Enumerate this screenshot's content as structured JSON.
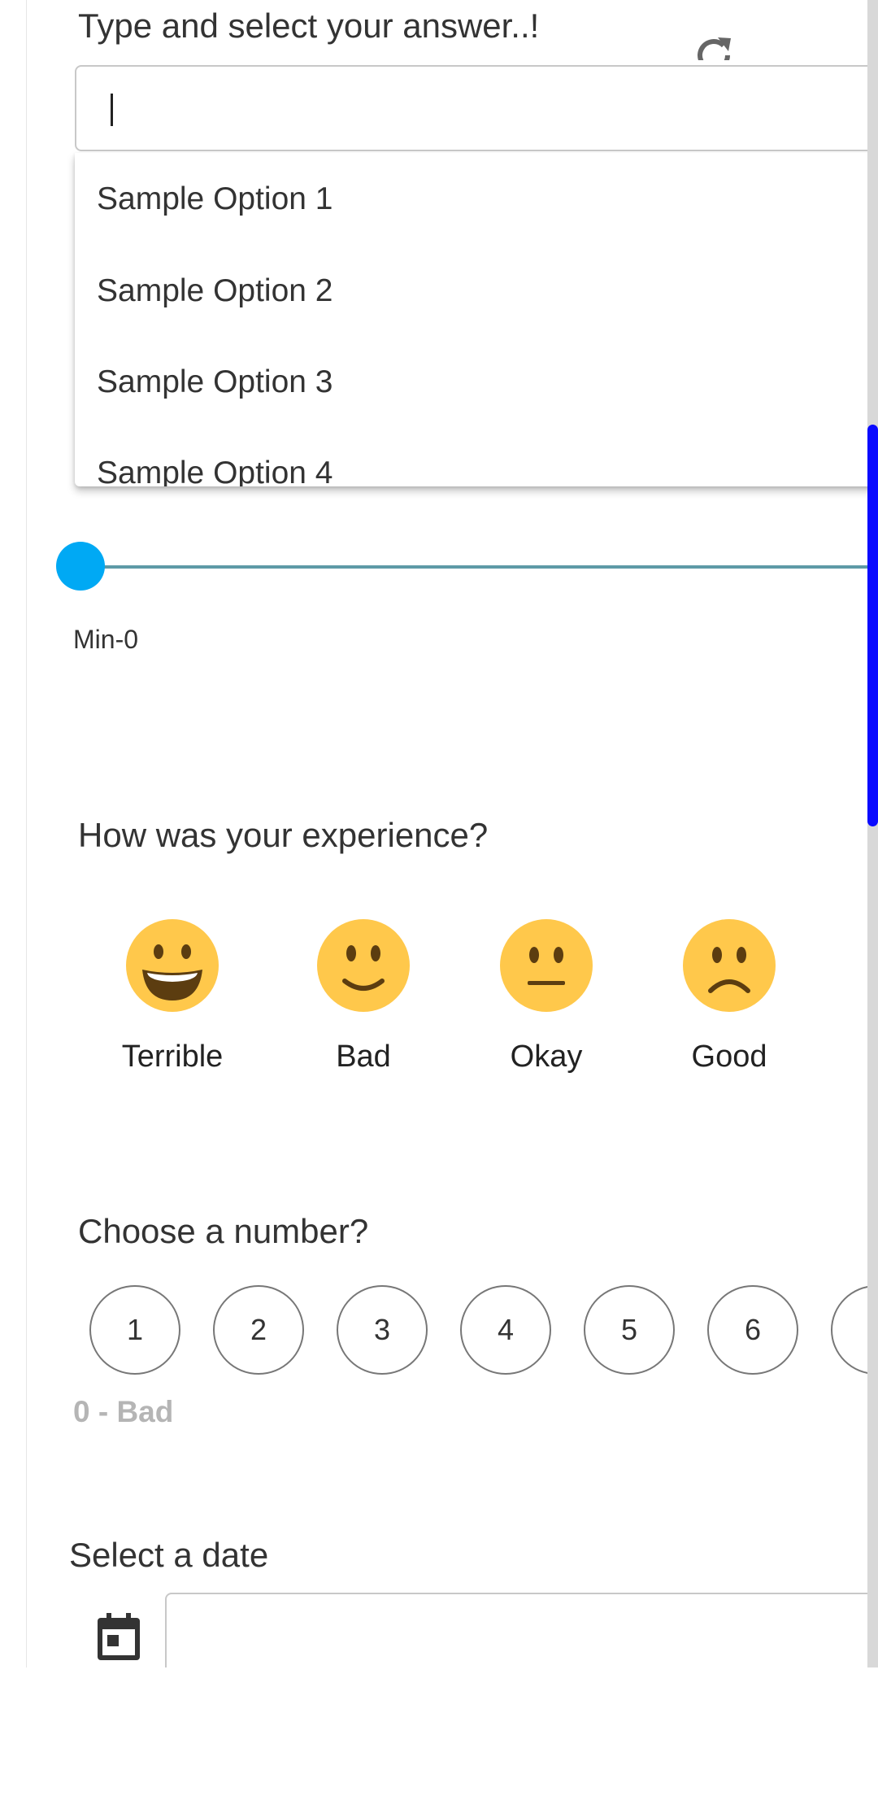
{
  "search": {
    "question": "Type and select your answer..!",
    "value": "",
    "options": [
      "Sample Option 1",
      "Sample Option 2",
      "Sample Option 3",
      "Sample Option 4"
    ]
  },
  "slider": {
    "min_label": "Min-0",
    "value_fraction": 0
  },
  "experience": {
    "question": "How was your experience?",
    "options": [
      {
        "label": "Terrible",
        "icon": "grinning-face-icon"
      },
      {
        "label": "Bad",
        "icon": "slightly-smiling-face-icon"
      },
      {
        "label": "Okay",
        "icon": "neutral-face-icon"
      },
      {
        "label": "Good",
        "icon": "frowning-face-icon"
      }
    ]
  },
  "number": {
    "question": "Choose a number?",
    "options": [
      "1",
      "2",
      "3",
      "4",
      "5",
      "6"
    ],
    "caption": "0 - Bad"
  },
  "date": {
    "question": "Select a date",
    "icon": "calendar-icon"
  },
  "colors": {
    "accent": "#00a9f4",
    "scroll_thumb": "#0a0aff",
    "emoji_fill": "#ffc84b"
  }
}
